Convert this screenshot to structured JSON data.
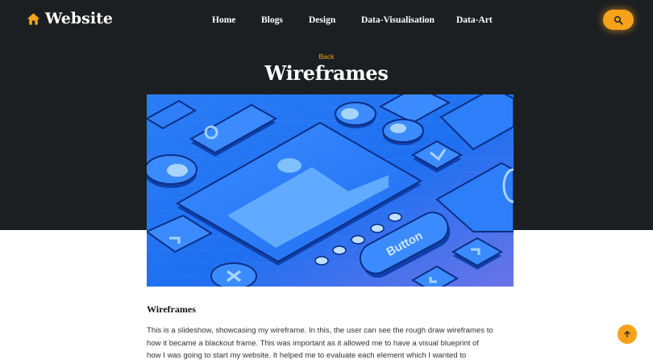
{
  "header": {
    "logo_text": "Website",
    "logo_icon": "home-icon",
    "nav": [
      "Home",
      "Blogs",
      "Design",
      "Data-Visualisation",
      "Data-Art"
    ],
    "search_icon": "search-icon"
  },
  "hero": {
    "back_label": "Back",
    "title": "Wireframes",
    "image_button_text": "Button"
  },
  "article": {
    "heading": "Wireframes",
    "lines": [
      "This is a slideshow, showcasing my wireframe. In this, the user can see the rough draw wireframes to",
      "how it became a blackout frame. This was important as it allowed me to have a visual blueprint of",
      "how I was going to start my website. It helped me to evaluate each element which I wanted to"
    ]
  },
  "scroll_top_icon": "arrow-up-icon",
  "colors": {
    "accent": "#f7a21b",
    "hero_bg": "#1c1f22",
    "image_blue": "#1e6ff0"
  }
}
